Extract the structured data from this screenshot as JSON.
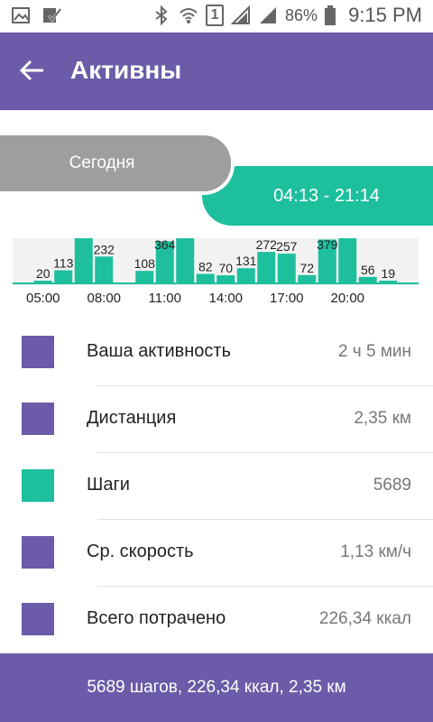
{
  "status_bar": {
    "battery": "86%",
    "time": "9:15 PM",
    "sim_label": "1",
    "icons": [
      "image-icon",
      "check-icon",
      "bluetooth-icon",
      "wifi-icon",
      "sim-icon",
      "signal-icon",
      "signal-icon",
      "battery-icon"
    ]
  },
  "app_bar": {
    "title": "Активны",
    "back_icon": "arrow-left-icon",
    "color": "#6b5ba8"
  },
  "tabs": {
    "today": "Сегодня",
    "range": "04:13 - 21:14"
  },
  "colors": {
    "accent": "#1dbf9d",
    "primary": "#6b5ba8",
    "inactive_tab": "#9e9e9e"
  },
  "chart_data": {
    "type": "bar",
    "categories": [
      "04:00",
      "05:00",
      "06:00",
      "07:00",
      "08:00",
      "09:00",
      "10:00",
      "11:00",
      "12:00",
      "13:00",
      "14:00",
      "15:00",
      "16:00",
      "17:00",
      "18:00",
      "19:00",
      "20:00",
      "21:00",
      "22:00",
      "23:00"
    ],
    "values": [
      0,
      20,
      113,
      400,
      232,
      0,
      108,
      364,
      450,
      82,
      70,
      131,
      272,
      257,
      72,
      379,
      420,
      56,
      19,
      0
    ],
    "data_labels": [
      "",
      "20",
      "113",
      "",
      "232",
      "",
      "108",
      "364",
      "",
      "82",
      "70",
      "131",
      "272",
      "257",
      "72",
      "379",
      "",
      "56",
      "19",
      ""
    ],
    "tick_labels": [
      "05:00",
      "08:00",
      "11:00",
      "14:00",
      "17:00",
      "20:00"
    ],
    "ylim": [
      0,
      390
    ],
    "color": "#1dbf9d",
    "grid": false
  },
  "stats": [
    {
      "label": "Ваша активность",
      "value": "2 ч 5 мин",
      "color": "#6b5ba8"
    },
    {
      "label": "Дистанция",
      "value": "2,35 км",
      "color": "#6b5ba8"
    },
    {
      "label": "Шаги",
      "value": "5689",
      "color": "#1dbf9d"
    },
    {
      "label": "Ср. скорость",
      "value": "1,13 км/ч",
      "color": "#6b5ba8"
    },
    {
      "label": "Всего потрачено",
      "value": "226,34 ккал",
      "color": "#6b5ba8"
    }
  ],
  "footer": {
    "summary": "5689 шагов, 226,34 ккал, 2,35 км"
  }
}
